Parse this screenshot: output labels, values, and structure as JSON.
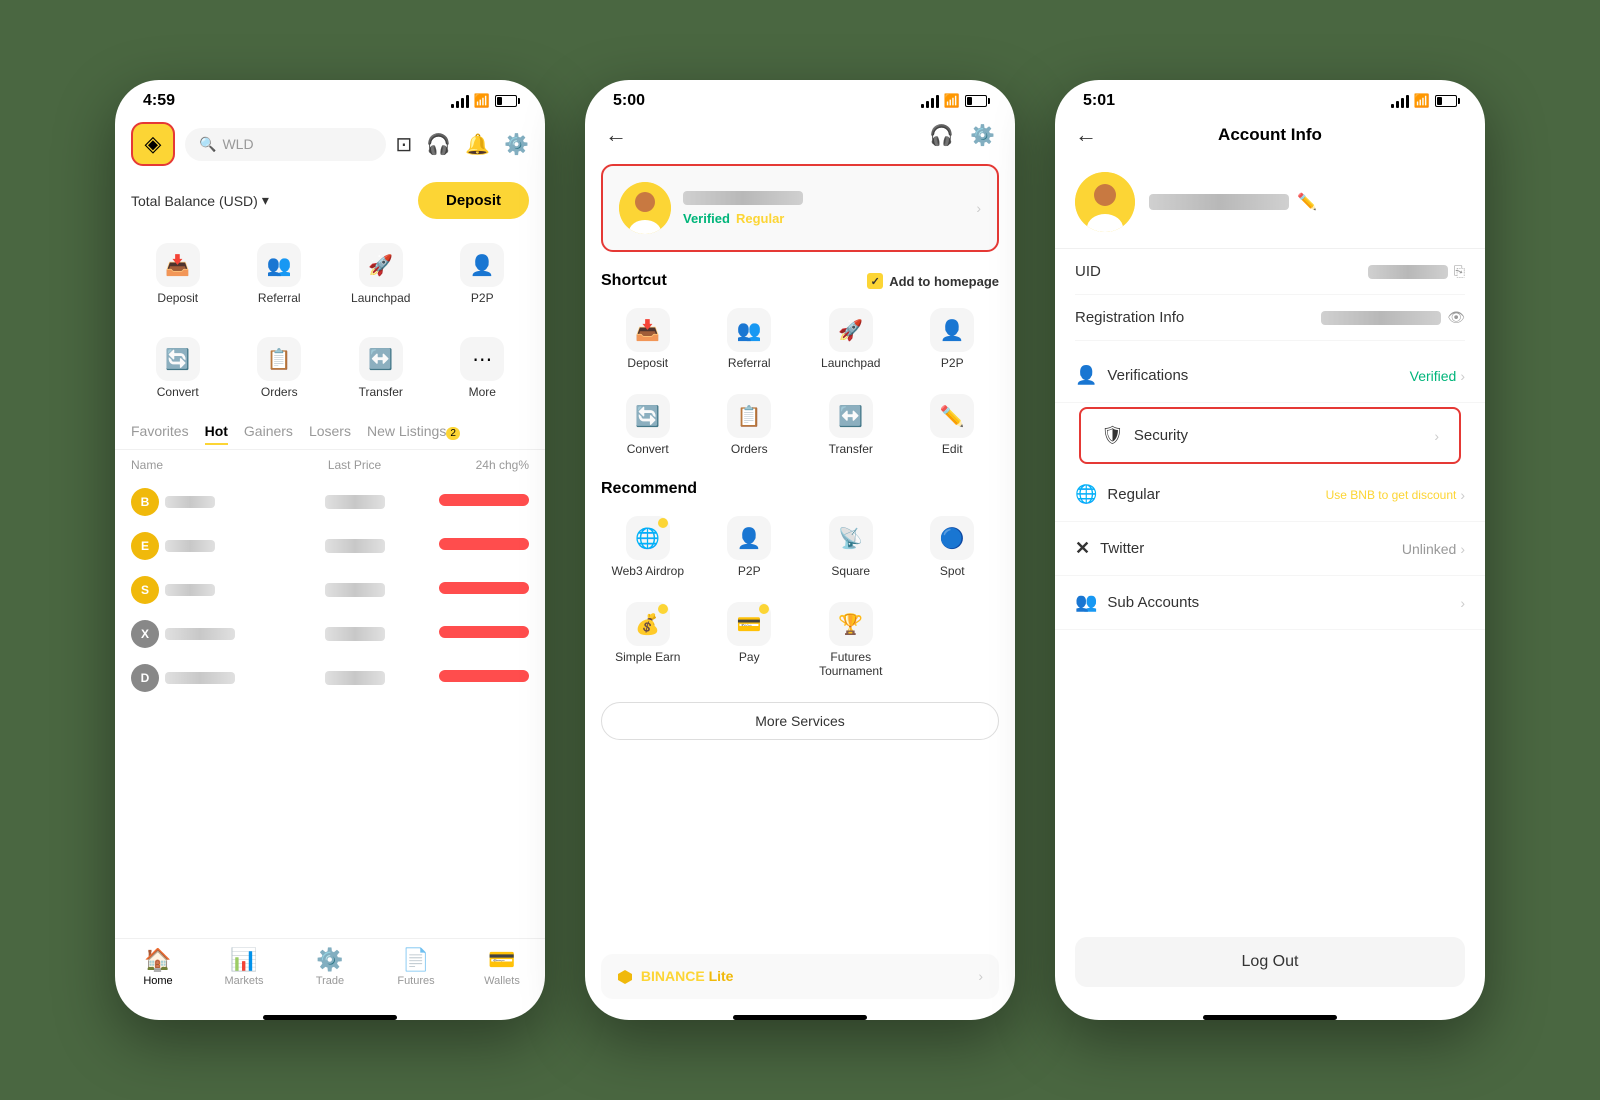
{
  "phone1": {
    "status": {
      "time": "4:59"
    },
    "header": {
      "search_placeholder": "WLD",
      "logo_icon": "◈"
    },
    "balance": {
      "label": "Total Balance (USD)",
      "deposit_btn": "Deposit"
    },
    "grid1": [
      {
        "id": "deposit",
        "icon": "📥",
        "label": "Deposit"
      },
      {
        "id": "referral",
        "icon": "👥",
        "label": "Referral"
      },
      {
        "id": "launchpad",
        "icon": "🚀",
        "label": "Launchpad"
      },
      {
        "id": "p2p",
        "icon": "👤",
        "label": "P2P"
      }
    ],
    "grid2": [
      {
        "id": "convert",
        "icon": "🔄",
        "label": "Convert"
      },
      {
        "id": "orders",
        "icon": "📋",
        "label": "Orders"
      },
      {
        "id": "transfer",
        "icon": "↔️",
        "label": "Transfer"
      },
      {
        "id": "more",
        "icon": "⋯",
        "label": "More"
      }
    ],
    "tabs": [
      {
        "id": "favorites",
        "label": "Favorites",
        "active": false
      },
      {
        "id": "hot",
        "label": "Hot",
        "active": true
      },
      {
        "id": "gainers",
        "label": "Gainers",
        "active": false
      },
      {
        "id": "losers",
        "label": "Losers",
        "active": false
      },
      {
        "id": "new-listings",
        "label": "New Listings",
        "active": false
      },
      {
        "id": "count",
        "label": "2",
        "active": false
      }
    ],
    "market_headers": {
      "name": "Name",
      "price": "Last Price",
      "change": "24h chg%"
    },
    "market_rows": [
      {
        "coin_color": "#F0B90B",
        "has_yellow": true
      },
      {
        "coin_color": "#F0B90B",
        "has_yellow": true
      },
      {
        "coin_color": "#F0B90B",
        "has_yellow": true
      },
      {
        "coin_color": "#888",
        "has_yellow": false
      },
      {
        "coin_color": "#888",
        "has_yellow": false
      }
    ],
    "bottom_nav": [
      {
        "id": "home",
        "icon": "🏠",
        "label": "Home",
        "active": true
      },
      {
        "id": "markets",
        "icon": "📊",
        "label": "Markets",
        "active": false
      },
      {
        "id": "trade",
        "icon": "⚙️",
        "label": "Trade",
        "active": false
      },
      {
        "id": "futures",
        "icon": "📄",
        "label": "Futures",
        "active": false
      },
      {
        "id": "wallets",
        "icon": "💳",
        "label": "Wallets",
        "active": false
      }
    ]
  },
  "phone2": {
    "status": {
      "time": "5:00"
    },
    "profile": {
      "verified_label": "Verified",
      "regular_label": "Regular"
    },
    "shortcut_section": "Shortcut",
    "add_homepage": "Add to homepage",
    "shortcuts": [
      {
        "id": "deposit",
        "icon": "📥",
        "label": "Deposit"
      },
      {
        "id": "referral",
        "icon": "👥",
        "label": "Referral"
      },
      {
        "id": "launchpad",
        "icon": "🚀",
        "label": "Launchpad"
      },
      {
        "id": "p2p",
        "icon": "👤",
        "label": "P2P"
      },
      {
        "id": "convert",
        "icon": "🔄",
        "label": "Convert"
      },
      {
        "id": "orders",
        "icon": "📋",
        "label": "Orders"
      },
      {
        "id": "transfer",
        "icon": "↔️",
        "label": "Transfer"
      },
      {
        "id": "edit",
        "icon": "✏️",
        "label": "Edit"
      }
    ],
    "recommend_section": "Recommend",
    "recommends": [
      {
        "id": "web3-airdrop",
        "icon": "🌐",
        "label": "Web3 Airdrop"
      },
      {
        "id": "p2p",
        "icon": "👤",
        "label": "P2P"
      },
      {
        "id": "square",
        "icon": "📡",
        "label": "Square"
      },
      {
        "id": "spot",
        "icon": "🔵",
        "label": "Spot"
      },
      {
        "id": "simple-earn",
        "icon": "💰",
        "label": "Simple Earn"
      },
      {
        "id": "pay",
        "icon": "💳",
        "label": "Pay"
      },
      {
        "id": "futures-tournament",
        "icon": "🏆",
        "label": "Futures Tournament"
      }
    ],
    "more_services_btn": "More Services",
    "binance_lite": {
      "logo_text": "BINANCE",
      "lite_text": "Lite"
    }
  },
  "phone3": {
    "status": {
      "time": "5:01"
    },
    "title": "Account Info",
    "uid_label": "UID",
    "reg_info_label": "Registration Info",
    "menu_items": [
      {
        "id": "verifications",
        "icon": "👤",
        "label": "Verifications",
        "value": "Verified",
        "value_color": "green"
      },
      {
        "id": "security",
        "icon": "🛡",
        "label": "Security",
        "value": "",
        "value_color": "",
        "highlighted": true
      },
      {
        "id": "regular",
        "icon": "🌐",
        "label": "Regular",
        "value": "Use BNB to get discount",
        "value_color": "yellow"
      },
      {
        "id": "twitter",
        "icon": "✕",
        "label": "Twitter",
        "value": "Unlinked",
        "value_color": "gray"
      },
      {
        "id": "sub-accounts",
        "icon": "👥",
        "label": "Sub Accounts",
        "value": "",
        "value_color": ""
      }
    ],
    "logout_btn": "Log Out"
  }
}
